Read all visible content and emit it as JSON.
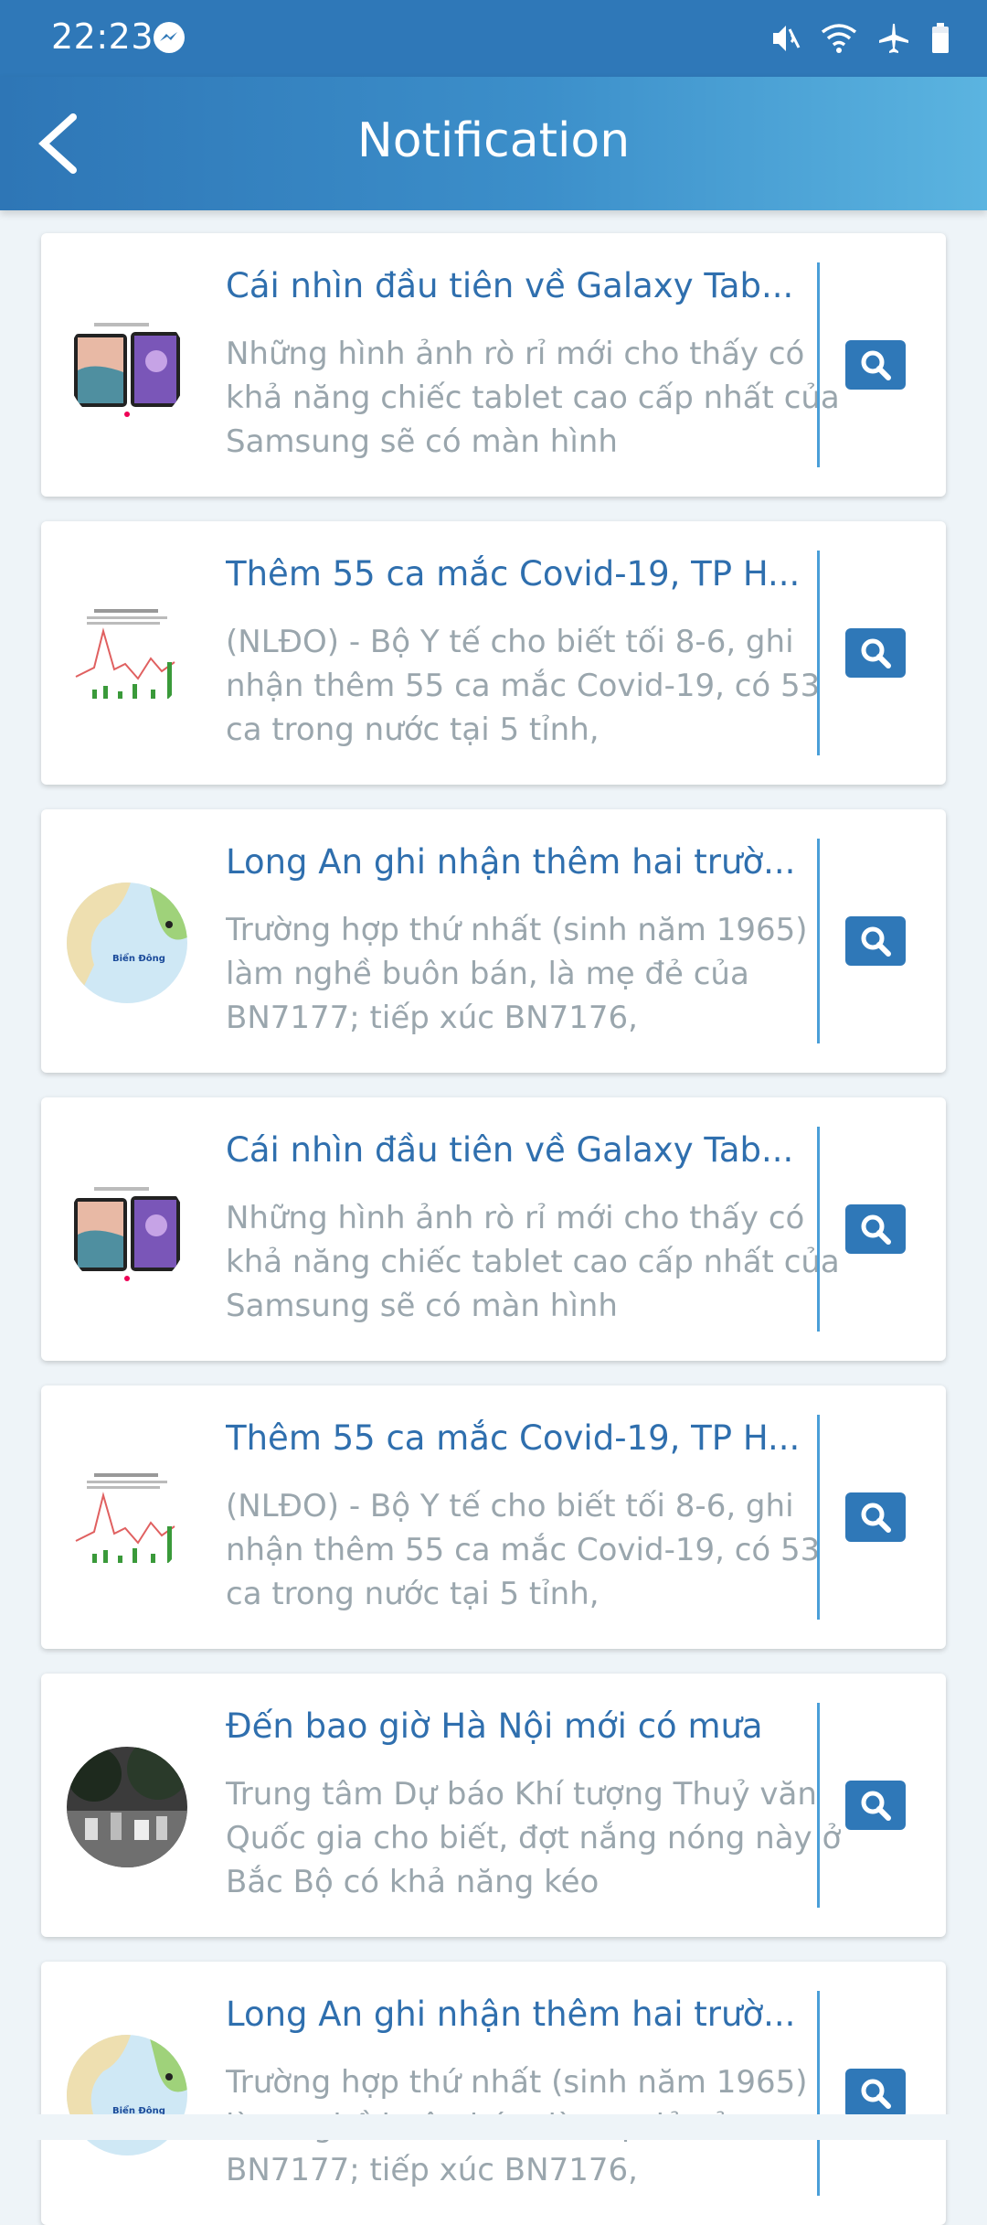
{
  "status_bar": {
    "time": "22:23",
    "icons": [
      "messenger-icon",
      "mute-icon",
      "wifi-icon",
      "airplane-icon",
      "battery-icon"
    ]
  },
  "app_bar": {
    "title": "Notification",
    "back_icon": "chevron-left-icon"
  },
  "notifications": [
    {
      "title": "Cái nhìn đầu tiên về Galaxy Tab...",
      "description": "Những hình ảnh rò rỉ mới cho thấy có khả năng chiếc tablet cao cấp nhất của Samsung sẽ có màn hình",
      "thumbnail": "tablet-image"
    },
    {
      "title": "Thêm 55 ca mắc Covid-19, TP H...",
      "description": "(NLĐO) - Bộ Y tế cho biết tối 8-6, ghi nhận thêm 55 ca mắc Covid-19, có 53 ca trong nước tại 5 tỉnh,",
      "thumbnail": "covid-chart-image"
    },
    {
      "title": "Long An ghi nhận thêm hai trườ...",
      "description": "Trường hợp thứ nhất (sinh năm 1965) làm nghề buôn bán, là mẹ đẻ của BN7177; tiếp xúc BN7176,",
      "thumbnail": "map-image",
      "thumb_label": "Biển Đông"
    },
    {
      "title": "Cái nhìn đầu tiên về Galaxy Tab...",
      "description": "Những hình ảnh rò rỉ mới cho thấy có khả năng chiếc tablet cao cấp nhất của Samsung sẽ có màn hình",
      "thumbnail": "tablet-image"
    },
    {
      "title": "Thêm 55 ca mắc Covid-19, TP H...",
      "description": "(NLĐO) - Bộ Y tế cho biết tối 8-6, ghi nhận thêm 55 ca mắc Covid-19, có 53 ca trong nước tại 5 tỉnh,",
      "thumbnail": "covid-chart-image"
    },
    {
      "title": "Đến bao giờ Hà Nội mới có mưa",
      "description": "Trung tâm Dự báo Khí tượng Thuỷ văn Quốc gia cho biết, đợt nắng nóng này ở Bắc Bộ có khả năng kéo",
      "thumbnail": "street-photo-image"
    },
    {
      "title": "Long An ghi nhận thêm hai trườ...",
      "description": "Trường hợp thứ nhất (sinh năm 1965) làm nghề buôn bán, là mẹ đẻ của BN7177; tiếp xúc BN7176,",
      "thumbnail": "map-image",
      "thumb_label": "Biển Đông"
    }
  ],
  "colors": {
    "primary": "#2f78b8",
    "title_text": "#2f6fae",
    "desc_text": "#9aa6ad",
    "background": "#eef4f8"
  }
}
